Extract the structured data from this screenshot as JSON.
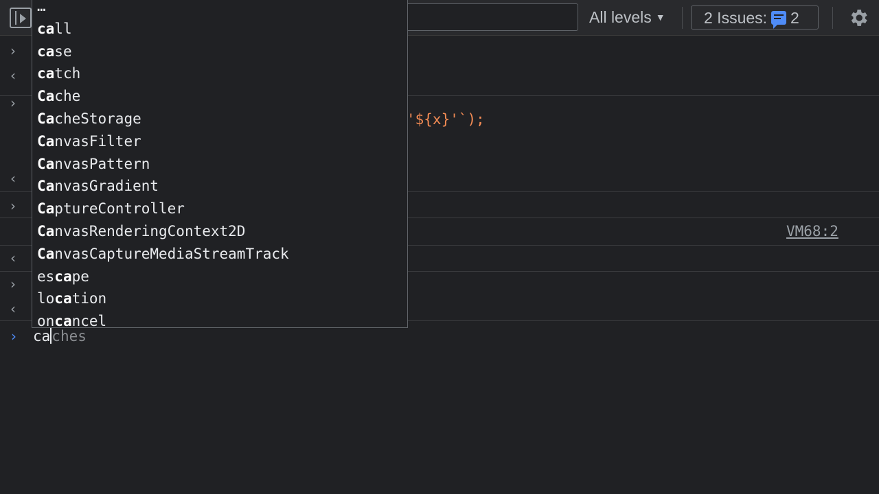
{
  "toolbar": {
    "levels_label": "All levels",
    "levels_caret": "▼",
    "issues_label": "2 Issues:",
    "issues_count": "2"
  },
  "console": {
    "line_code": "'${x}'`);",
    "source_link": "VM68:2"
  },
  "prompt": {
    "typed_before_caret": "ca",
    "ghost_completion": "ches"
  },
  "autocomplete": {
    "items": [
      {
        "match": "",
        "rest": "…"
      },
      {
        "match": "ca",
        "rest": "ll"
      },
      {
        "match": "ca",
        "rest": "se"
      },
      {
        "match": "ca",
        "rest": "tch"
      },
      {
        "match": "Ca",
        "rest": "che"
      },
      {
        "match": "Ca",
        "rest": "cheStorage"
      },
      {
        "match": "Ca",
        "rest": "nvasFilter"
      },
      {
        "match": "Ca",
        "rest": "nvasPattern"
      },
      {
        "match": "Ca",
        "rest": "nvasGradient"
      },
      {
        "match": "Ca",
        "rest": "ptureController"
      },
      {
        "match": "Ca",
        "rest": "nvasRenderingContext2D"
      },
      {
        "match": "Ca",
        "rest": "nvasCaptureMediaStreamTrack"
      },
      {
        "prefix": "es",
        "match": "ca",
        "rest": "pe"
      },
      {
        "prefix": "lo",
        "match": "ca",
        "rest": "tion"
      },
      {
        "prefix": "on",
        "match": "ca",
        "rest": "ncel"
      },
      {
        "prefix": "",
        "match": "",
        "rest": "…"
      }
    ]
  },
  "colors": {
    "background": "#202124",
    "accent_blue": "#4f8cf7",
    "string_orange": "#f28b54"
  }
}
